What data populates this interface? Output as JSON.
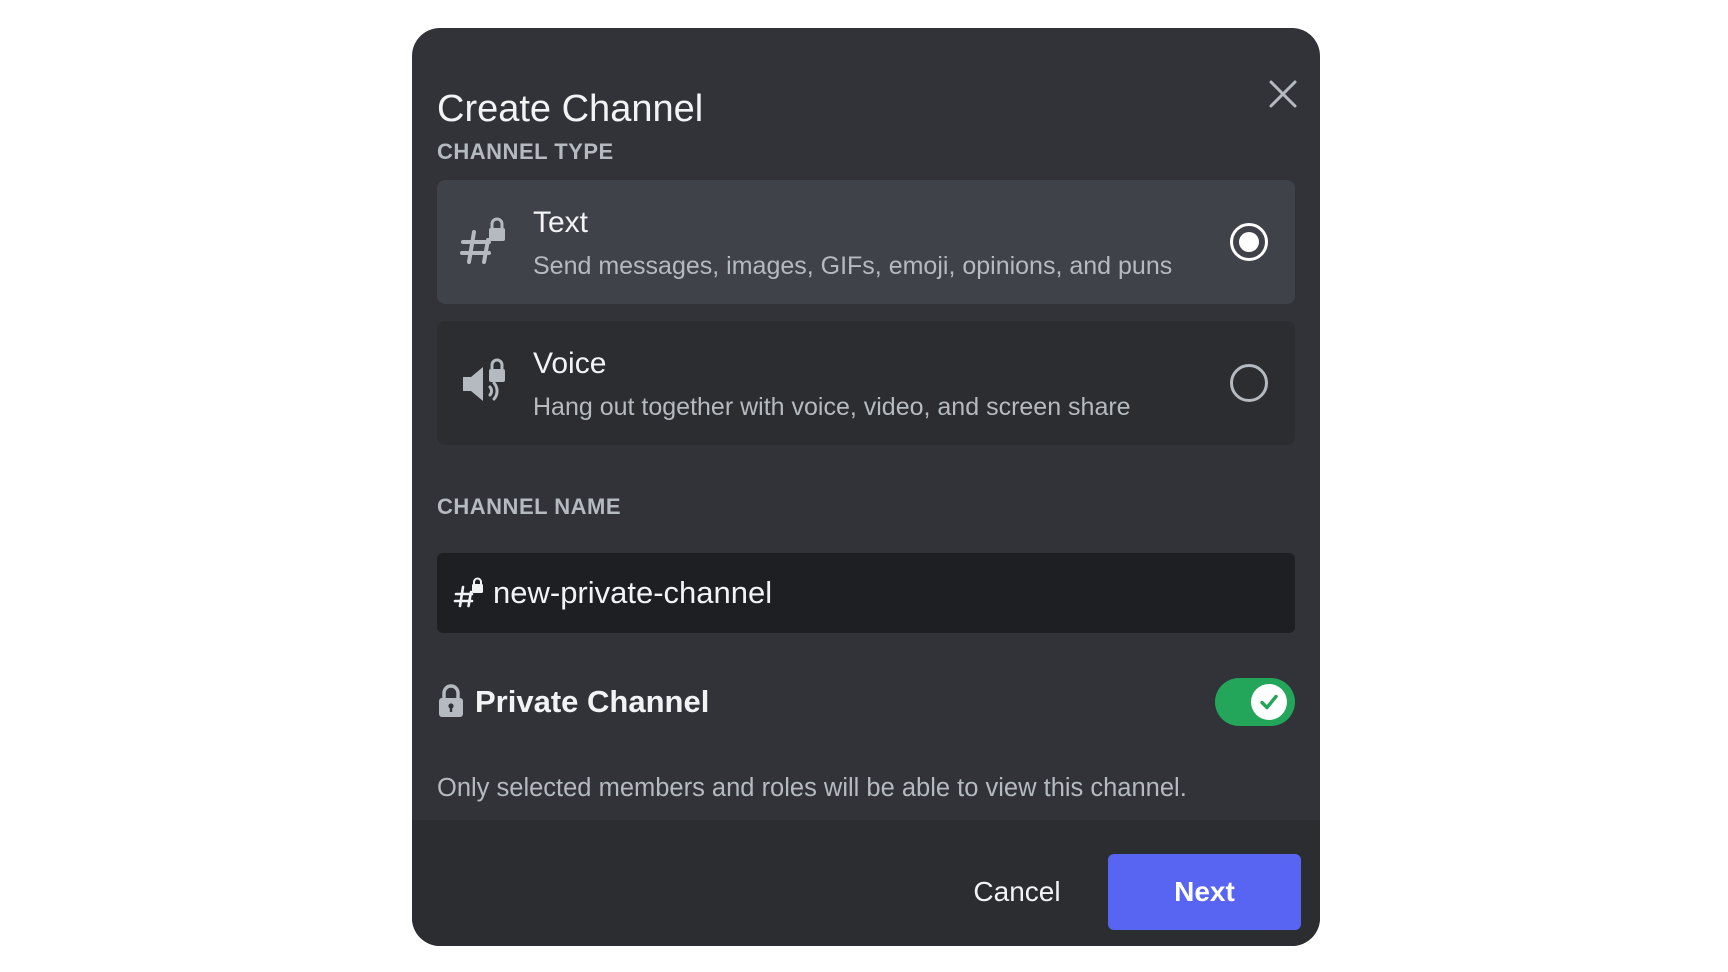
{
  "modal": {
    "title": "Create Channel",
    "close_icon": "close-icon"
  },
  "channel_type": {
    "label": "CHANNEL TYPE",
    "options": [
      {
        "name": "Text",
        "description": "Send messages, images, GIFs, emoji, opinions, and puns",
        "icon": "hashtag-lock-icon",
        "selected": true
      },
      {
        "name": "Voice",
        "description": "Hang out together with voice, video, and screen share",
        "icon": "speaker-lock-icon",
        "selected": false
      }
    ]
  },
  "channel_name": {
    "label": "CHANNEL NAME",
    "value": "new-private-channel",
    "icon": "hashtag-lock-icon"
  },
  "private_channel": {
    "label": "Private Channel",
    "description": "Only selected members and roles will be able to view this channel.",
    "enabled": true,
    "icon": "lock-icon"
  },
  "footer": {
    "cancel_label": "Cancel",
    "next_label": "Next"
  },
  "colors": {
    "modal_bg": "#313338",
    "footer_bg": "#2b2d31",
    "selected_option_bg": "#404249",
    "input_bg": "#1e1f22",
    "accent_blurple": "#5865f2",
    "toggle_green": "#23a55a"
  }
}
